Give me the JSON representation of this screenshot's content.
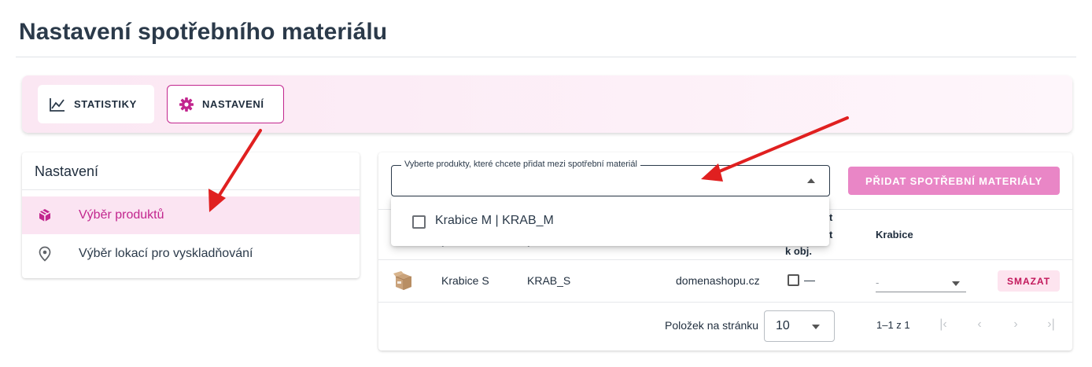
{
  "page": {
    "title": "Nastavení spotřebního materiálu"
  },
  "tabs": [
    {
      "label": "STATISTIKY",
      "icon": "line-chart-icon"
    },
    {
      "label": "NASTAVENÍ",
      "icon": "gear-icon",
      "active": true
    }
  ],
  "sidebar": {
    "title": "Nastavení",
    "items": [
      {
        "label": "Výběr produktů",
        "icon": "package-icon",
        "active": true
      },
      {
        "label": "Výběr lokací pro vyskladňování",
        "icon": "location-pin-icon"
      }
    ]
  },
  "product_select": {
    "label": "Vyberte produkty, které chcete přidat mezi spotřební materiál",
    "value": "",
    "options": [
      {
        "label": "Krabice M | KRAB_M",
        "checked": false
      }
    ]
  },
  "add_button": {
    "label": "PŘIDAT SPOTŘEBNÍ MATERIÁLY"
  },
  "table": {
    "headers": {
      "col_a": "p",
      "col_b": "p",
      "col_c_line1": "t",
      "col_c_line2": "t",
      "col_c_line3": "k obj.",
      "box": "Krabice"
    },
    "rows": [
      {
        "name": "Krabice S",
        "code": "KRAB_S",
        "shop": "domenashopu.cz",
        "checked": false,
        "dash": "—",
        "box_value": "-",
        "delete_label": "SMAZAT"
      }
    ]
  },
  "pagination": {
    "per_page_label": "Položek na stránku",
    "per_page_value": "10",
    "range": "1–1 z 1",
    "first": "|‹",
    "prev": "‹",
    "next": "›",
    "last": "›|"
  },
  "colors": {
    "accent": "#c2268e",
    "add_button": "#e986c6",
    "annotation_arrow": "#e02020"
  }
}
